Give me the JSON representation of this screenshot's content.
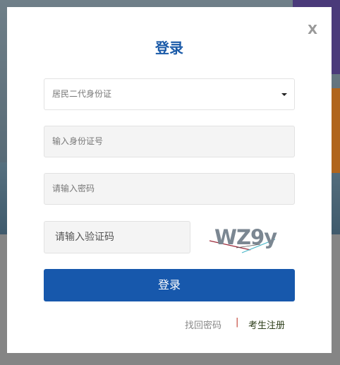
{
  "modal": {
    "close_label": "X",
    "title": "登录"
  },
  "form": {
    "id_type_selected": "居民二代身份证",
    "id_number_placeholder": "输入身份证号",
    "password_placeholder": "请输入密码",
    "captcha_placeholder": "请输入验证码",
    "captcha_text": "WZ9y",
    "submit_label": "登录"
  },
  "links": {
    "forgot_password": "找回密码",
    "separator": "|",
    "register": "考生注册"
  },
  "colors": {
    "accent": "#1758ac",
    "title": "#1a5aa8",
    "separator": "#c0392b"
  },
  "icons": {
    "close": "close-icon",
    "dropdown": "caret-down-icon"
  }
}
